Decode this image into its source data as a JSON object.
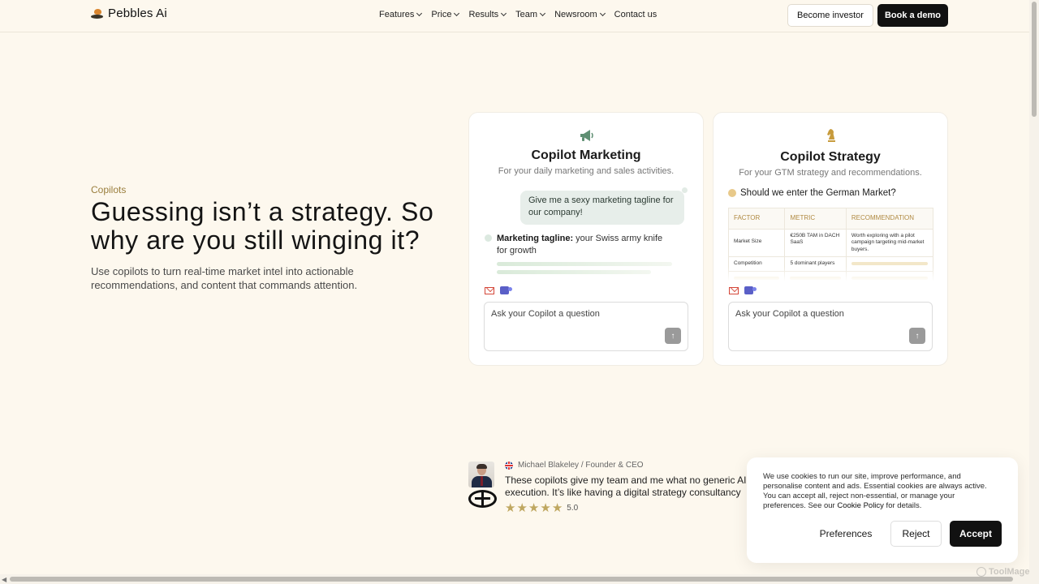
{
  "brand": {
    "name": "Pebbles Ai"
  },
  "nav": {
    "items": [
      {
        "label": "Features",
        "dropdown": true
      },
      {
        "label": "Price",
        "dropdown": true
      },
      {
        "label": "Results",
        "dropdown": true
      },
      {
        "label": "Team",
        "dropdown": true
      },
      {
        "label": "Newsroom",
        "dropdown": true
      },
      {
        "label": "Contact us",
        "dropdown": false
      }
    ],
    "investor_label": "Become investor",
    "demo_label": "Book a demo"
  },
  "hero": {
    "eyebrow": "Copilots",
    "headline": "Guessing isn’t a strategy. So why are you still winging it?",
    "subline": "Use copilots to turn real-time market intel into actionable recommendations, and content that commands attention."
  },
  "cards": {
    "marketing": {
      "icon": "megaphone-icon",
      "title": "Copilot Marketing",
      "subtitle": "For your daily marketing and sales activities.",
      "question": "Give me a sexy marketing tagline for our company!",
      "answer_label": "Marketing tagline:",
      "answer_text": " your Swiss army knife for growth",
      "ask_placeholder": "Ask your Copilot a question"
    },
    "strategy": {
      "icon": "chess-knight-icon",
      "title": "Copilot Strategy",
      "subtitle": "For your GTM strategy and recommendations.",
      "question": "Should we enter the German Market?",
      "table": {
        "headers": [
          "FACTOR",
          "METRIC",
          "RECOMMENDATION"
        ],
        "rows": [
          [
            "Market Size",
            "€250B TAM in DACH SaaS",
            "Worth exploring with a pilot campaign targeting mid-market buyers."
          ],
          [
            "Competition",
            "5 dominant players",
            ""
          ]
        ]
      },
      "ask_placeholder": "Ask your Copilot a question"
    }
  },
  "testimonial": {
    "author": "Michael Blakeley / Founder & CEO",
    "quote_line1": "These copilots give my team and me what no generic AI",
    "quote_line2": "execution. It’s like having a digital strategy consultancy",
    "rating": "5.0",
    "stars": 5
  },
  "cookie": {
    "text_before": "We use cookies to run our site, improve performance, and personalise content and ads. Essential cookies are always active. You can accept all, reject non-essential, or manage your preferences. See our ",
    "link": "Cookie Policy",
    "text_after": " for details.",
    "preferences_label": "Preferences",
    "reject_label": "Reject",
    "accept_label": "Accept"
  },
  "watermark": "ToolMage",
  "colors": {
    "accent_gold": "#9a7e3d",
    "background": "#fdf8ee",
    "dark": "#111111"
  }
}
